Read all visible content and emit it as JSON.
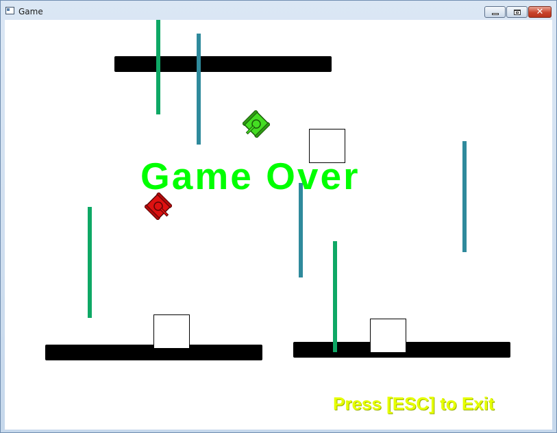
{
  "window": {
    "title": "Game",
    "close_glyph": "✕"
  },
  "game": {
    "status_text": "Game Over",
    "exit_hint": "Press [ESC] to Exit",
    "colors": {
      "status_text": "#00ff00",
      "exit_hint": "#e6ff00",
      "wall": "#000000",
      "green_bar": "#0ea865",
      "teal_bar": "#2f8a9c",
      "player_tank": "#44dd22",
      "enemy_tank": "#dd1111"
    },
    "tanks": [
      {
        "name": "player-tank",
        "color": "green",
        "icon": "tank-icon"
      },
      {
        "name": "enemy-tank",
        "color": "red",
        "icon": "tank-icon"
      }
    ]
  }
}
